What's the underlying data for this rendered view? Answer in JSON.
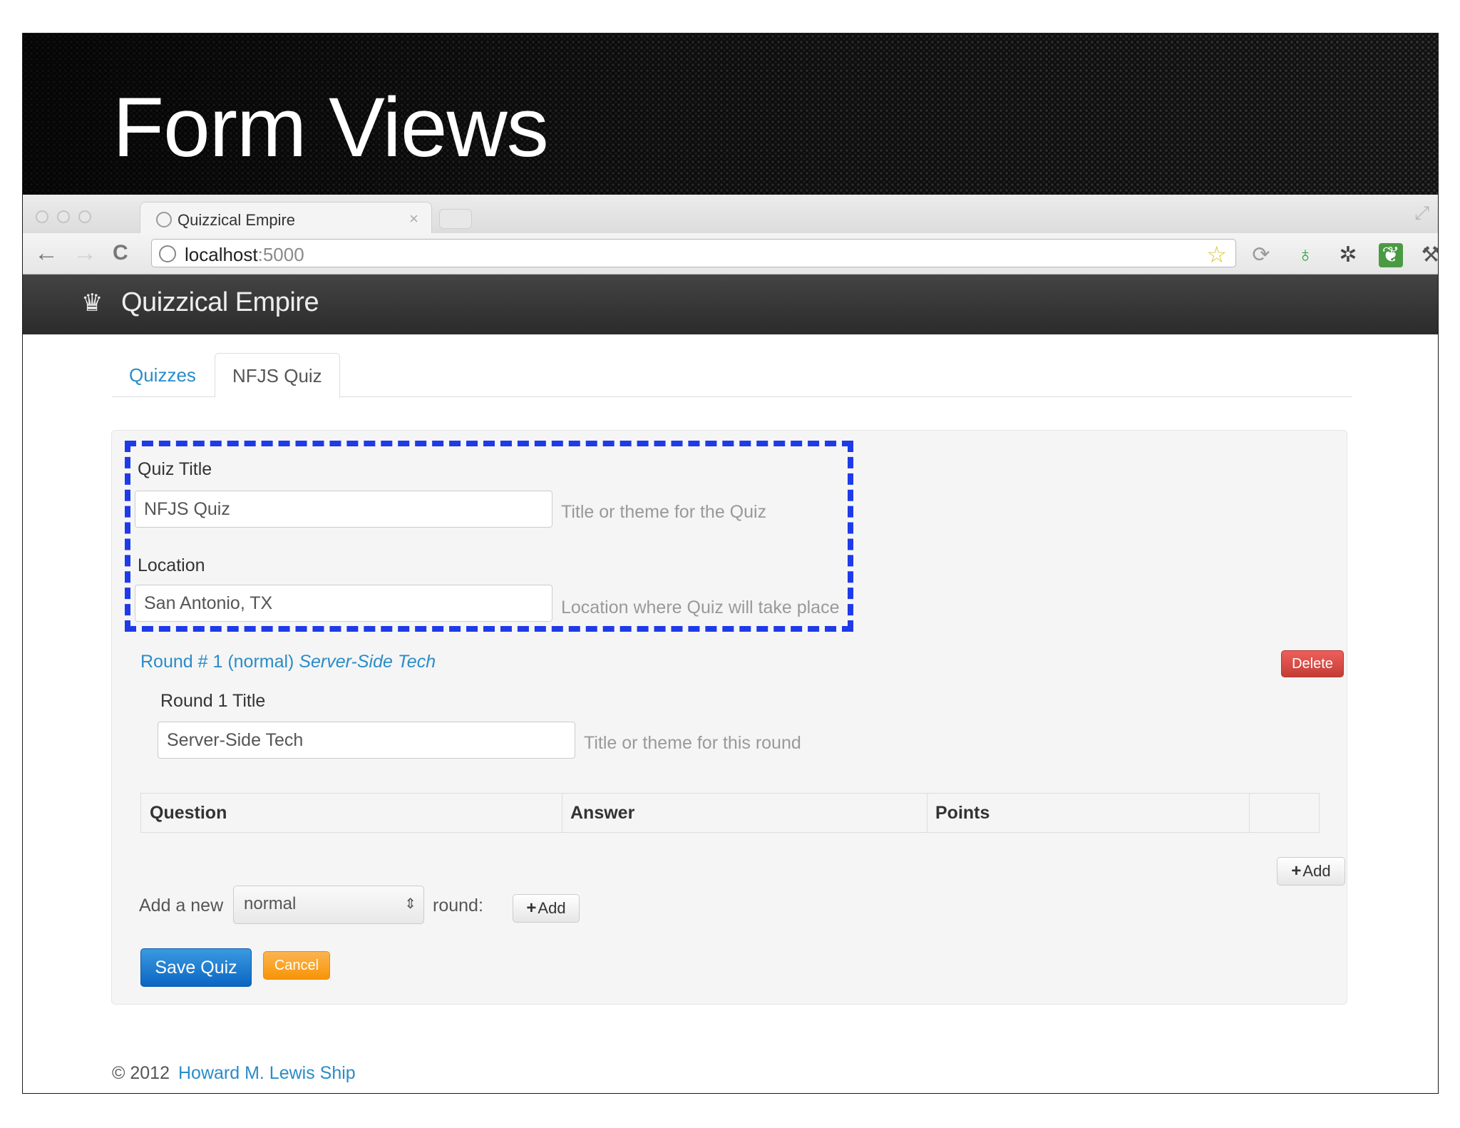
{
  "slide": {
    "title": "Form Views"
  },
  "browser": {
    "tab_title": "Quizzical Empire",
    "tab_close": "×",
    "url_host": "localhost",
    "url_port": ":5000",
    "nav": {
      "back": "←",
      "forward": "→",
      "reload": "C"
    },
    "extensions": [
      "star-icon",
      "sync-icon",
      "green-extension-icon",
      "wrench-puzzle-icon",
      "evernote-icon",
      "wrench-icon"
    ]
  },
  "app": {
    "brand": "Quizzical Empire",
    "tabs": [
      {
        "label": "Quizzes",
        "active": false
      },
      {
        "label": "NFJS Quiz",
        "active": true
      }
    ]
  },
  "form": {
    "quiz_title_label": "Quiz Title",
    "quiz_title_value": "NFJS Quiz",
    "quiz_title_help": "Title or theme for the Quiz",
    "location_label": "Location",
    "location_value": "San Antonio, TX",
    "location_help": "Location where Quiz will take place",
    "round": {
      "prefix": "Round # 1 (normal)",
      "name": "Server-Side Tech",
      "delete_label": "Delete",
      "title_label": "Round 1 Title",
      "title_value": "Server-Side Tech",
      "title_help": "Title or theme for this round",
      "table_headers": [
        "Question",
        "Answer",
        "Points"
      ],
      "add_question_label": "Add"
    },
    "add_round": {
      "prefix": "Add a new",
      "type_selected": "normal",
      "suffix": "round:",
      "add_label": "Add"
    },
    "save_label": "Save Quiz",
    "cancel_label": "Cancel"
  },
  "footer": {
    "copyright": "© 2012",
    "author": "Howard M. Lewis Ship"
  },
  "colors": {
    "link": "#2a8cc8",
    "highlight_dashes": "#1f3ae8",
    "delete": "#c43c35",
    "primary": "#0a66c2",
    "warning": "#f89406"
  }
}
